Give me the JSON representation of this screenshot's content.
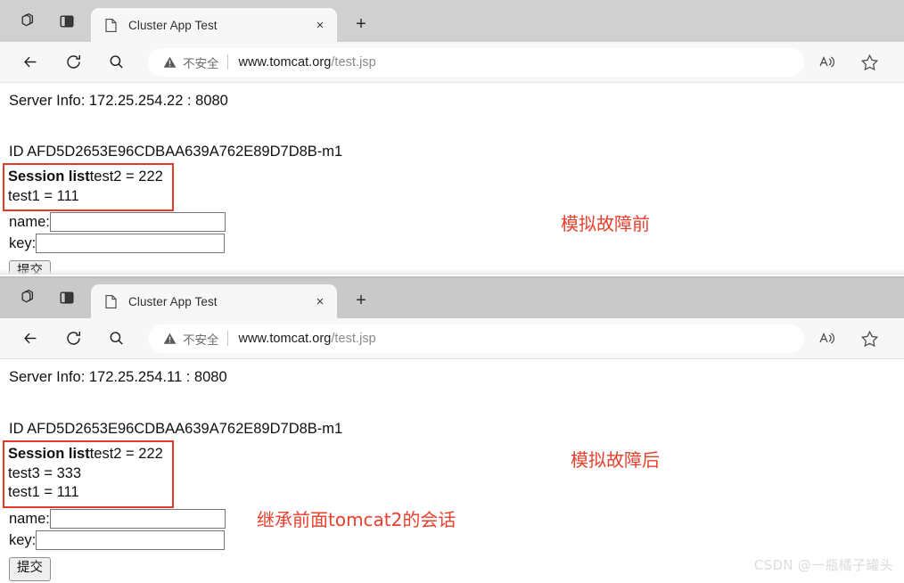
{
  "browser": {
    "tabstrip_icons": [
      {
        "name": "tab-actions-icon"
      },
      {
        "name": "split-screen-icon"
      }
    ],
    "tab": {
      "title": "Cluster App Test",
      "favicon": "page-icon",
      "close_label": "×"
    },
    "newtab_label": "+",
    "nav": {
      "back_icon": "back-arrow-icon",
      "reload_icon": "reload-icon",
      "search_icon": "search-icon",
      "read_aloud_icon": "read-aloud-icon",
      "favorite_icon": "star-icon"
    },
    "address": {
      "security_warning": "不安全",
      "warning_icon": "warning-triangle-icon",
      "url_host": "www.tomcat.org",
      "url_path": "/test.jsp",
      "full_url": "www.tomcat.org/test.jsp"
    }
  },
  "windows": [
    {
      "id": "window-top",
      "server_info": "Server Info: 172.25.254.22 : 8080",
      "session_id": "ID AFD5D2653E96CDBAA639A762E89D7D8B-m1",
      "session_box": {
        "label": "Session list",
        "first_entry": "test2 = 222",
        "entries": [
          "test1 = 111"
        ]
      },
      "form": {
        "name_label": "name:",
        "name_value": "",
        "key_label": "key:",
        "key_value": "",
        "submit_label": "提交"
      }
    },
    {
      "id": "window-bottom",
      "server_info": "Server Info: 172.25.254.11 : 8080",
      "session_id": "ID AFD5D2653E96CDBAA639A762E89D7D8B-m1",
      "session_box": {
        "label": "Session list",
        "first_entry": "test2 = 222",
        "entries": [
          "test3 = 333",
          "test1 = 111"
        ]
      },
      "form": {
        "name_label": "name:",
        "name_value": "",
        "key_label": "key:",
        "key_value": "",
        "submit_label": "提交"
      }
    }
  ],
  "annotations": [
    {
      "text": "模拟故障前",
      "color": "#e8402d"
    },
    {
      "text": "模拟故障后",
      "color": "#e8402d"
    },
    {
      "text": "继承前面tomcat2的会话",
      "color": "#e8402d"
    }
  ],
  "watermark": "CSDN @一瓶橘子罐头"
}
